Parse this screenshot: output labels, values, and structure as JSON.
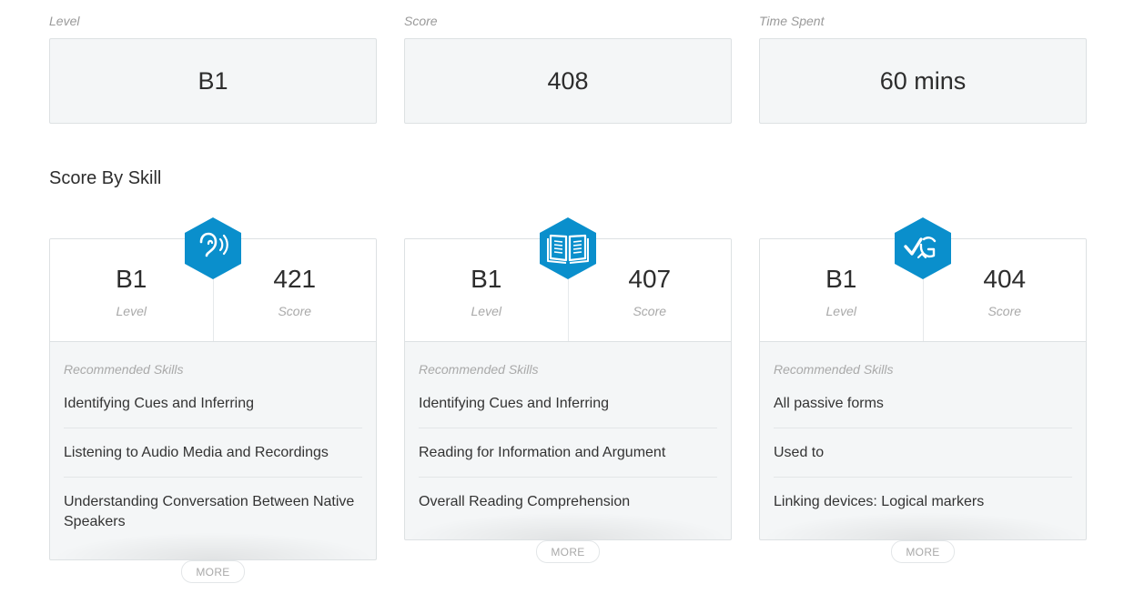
{
  "summary": [
    {
      "label": "Level",
      "value": "B1"
    },
    {
      "label": "Score",
      "value": "408"
    },
    {
      "label": "Time Spent",
      "value": "60 mins"
    }
  ],
  "section_title": "Score By Skill",
  "skills": [
    {
      "icon": "ear-listening-icon",
      "level_value": "B1",
      "level_label": "Level",
      "score_value": "421",
      "score_label": "Score",
      "recommended_label": "Recommended Skills",
      "items": [
        "Identifying Cues and Inferring",
        "Listening to Audio Media and Recordings",
        "Understanding Conversation Between Native Speakers"
      ],
      "more": "MORE"
    },
    {
      "icon": "open-book-icon",
      "level_value": "B1",
      "level_label": "Level",
      "score_value": "407",
      "score_label": "Score",
      "recommended_label": "Recommended Skills",
      "items": [
        "Identifying Cues and Inferring",
        "Reading for Information and Argument",
        "Overall Reading Comprehension"
      ],
      "more": "MORE"
    },
    {
      "icon": "grammar-check-icon",
      "level_value": "B1",
      "level_label": "Level",
      "score_value": "404",
      "score_label": "Score",
      "recommended_label": "Recommended Skills",
      "items": [
        "All passive forms",
        "Used to",
        "Linking devices: Logical markers"
      ],
      "more": "MORE"
    }
  ],
  "colors": {
    "accent": "#0a8fcc",
    "panel": "#f4f6f7",
    "border": "#dde1e3"
  }
}
